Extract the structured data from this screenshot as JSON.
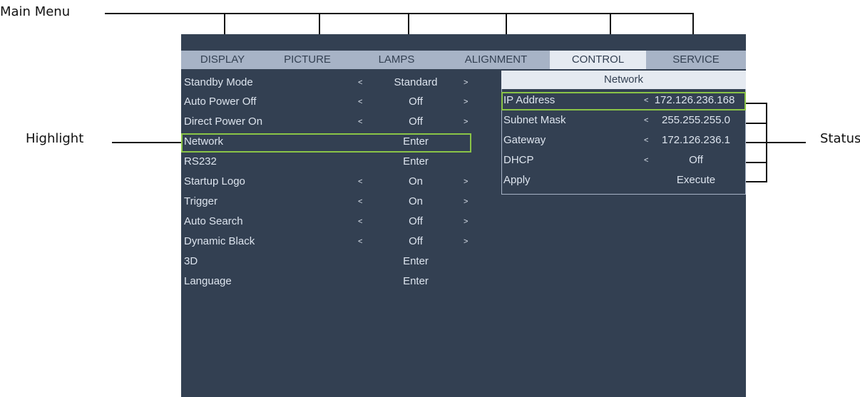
{
  "callouts": {
    "main_menu": "Main Menu",
    "highlight": "Highlight",
    "status": "Status"
  },
  "tabs": [
    {
      "label": "DISPLAY",
      "active": false
    },
    {
      "label": "PICTURE",
      "active": false
    },
    {
      "label": "LAMPS",
      "active": false
    },
    {
      "label": "ALIGNMENT",
      "active": false
    },
    {
      "label": "CONTROL",
      "active": true
    },
    {
      "label": "SERVICE",
      "active": false
    }
  ],
  "menu_items": [
    {
      "label": "Standby Mode",
      "value": "Standard",
      "left_arrow": "<",
      "right_arrow": ">"
    },
    {
      "label": "Auto Power Off",
      "value": "Off",
      "left_arrow": "<",
      "right_arrow": ">"
    },
    {
      "label": "Direct Power On",
      "value": "Off",
      "left_arrow": "<",
      "right_arrow": ">"
    },
    {
      "label": "Network",
      "value": "Enter",
      "left_arrow": "",
      "right_arrow": ""
    },
    {
      "label": "RS232",
      "value": "Enter",
      "left_arrow": "",
      "right_arrow": ""
    },
    {
      "label": "Startup Logo",
      "value": "On",
      "left_arrow": "<",
      "right_arrow": ">"
    },
    {
      "label": "Trigger",
      "value": "On",
      "left_arrow": "<",
      "right_arrow": ">"
    },
    {
      "label": "Auto Search",
      "value": "Off",
      "left_arrow": "<",
      "right_arrow": ">"
    },
    {
      "label": "Dynamic Black",
      "value": "Off",
      "left_arrow": "<",
      "right_arrow": ">"
    },
    {
      "label": "3D",
      "value": "Enter",
      "left_arrow": "",
      "right_arrow": ""
    },
    {
      "label": "Language",
      "value": "Enter",
      "left_arrow": "",
      "right_arrow": ""
    }
  ],
  "network": {
    "title": "Network",
    "items": [
      {
        "label": "IP Address",
        "value": "172.126.236.168",
        "left_arrow": "<"
      },
      {
        "label": "Subnet Mask",
        "value": "255.255.255.0",
        "left_arrow": "<"
      },
      {
        "label": "Gateway",
        "value": "172.126.236.1",
        "left_arrow": "<"
      },
      {
        "label": "DHCP",
        "value": "Off",
        "left_arrow": "<"
      },
      {
        "label": "Apply",
        "value": "Execute",
        "left_arrow": ""
      }
    ]
  },
  "colors": {
    "osd_background": "#334052",
    "tab_inactive": "#a7b3c6",
    "tab_active": "#e5eaf1",
    "highlight": "#8ac447"
  }
}
